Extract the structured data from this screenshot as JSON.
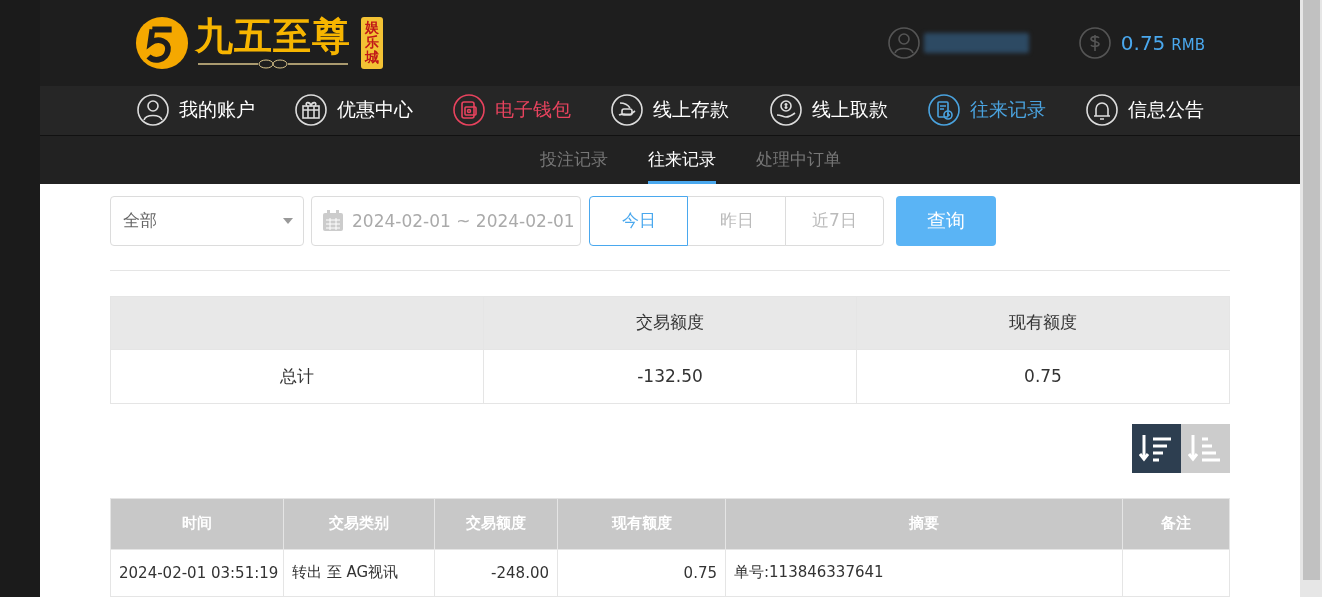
{
  "header": {
    "logo": {
      "name": "九五至尊",
      "tag": "娱乐城"
    },
    "balance": {
      "amount": "0.75",
      "currency": "RMB"
    }
  },
  "nav": [
    {
      "label": "我的账户",
      "kind": "user",
      "color": "#ffffff"
    },
    {
      "label": "优惠中心",
      "kind": "gift",
      "color": "#ffffff"
    },
    {
      "label": "电子钱包",
      "kind": "wallet",
      "color": "#e8435e"
    },
    {
      "label": "线上存款",
      "kind": "deposit",
      "color": "#ffffff"
    },
    {
      "label": "线上取款",
      "kind": "withdraw",
      "color": "#ffffff"
    },
    {
      "label": "往来记录",
      "kind": "records",
      "color": "#4aa3df"
    },
    {
      "label": "信息公告",
      "kind": "bell",
      "color": "#ffffff"
    }
  ],
  "sub_tabs": [
    {
      "label": "投注记录",
      "selected": false
    },
    {
      "label": "往来记录",
      "selected": true
    },
    {
      "label": "处理中订单",
      "selected": false
    }
  ],
  "filter": {
    "type_select": "全部",
    "date_range": "2024-02-01 ~ 2024-02-01",
    "quick_dates": [
      {
        "label": "今日",
        "selected": true
      },
      {
        "label": "昨日",
        "selected": false
      },
      {
        "label": "近7日",
        "selected": false
      }
    ],
    "query_button": "查询"
  },
  "summary": {
    "columns": [
      "交易额度",
      "现有额度"
    ],
    "row": [
      "总计",
      "-132.50",
      "0.75"
    ]
  },
  "sort_buttons": [
    {
      "kind": "desc",
      "selected": true
    },
    {
      "kind": "asc",
      "selected": false
    }
  ],
  "records": {
    "columns": [
      "时间",
      "交易类别",
      "交易额度",
      "现有额度",
      "摘要",
      "备注"
    ],
    "rows": [
      [
        "2024-02-01 03:51:19",
        "转出 至 AG视讯",
        "-248.00",
        "0.75",
        "单号:113846337641",
        ""
      ]
    ]
  }
}
